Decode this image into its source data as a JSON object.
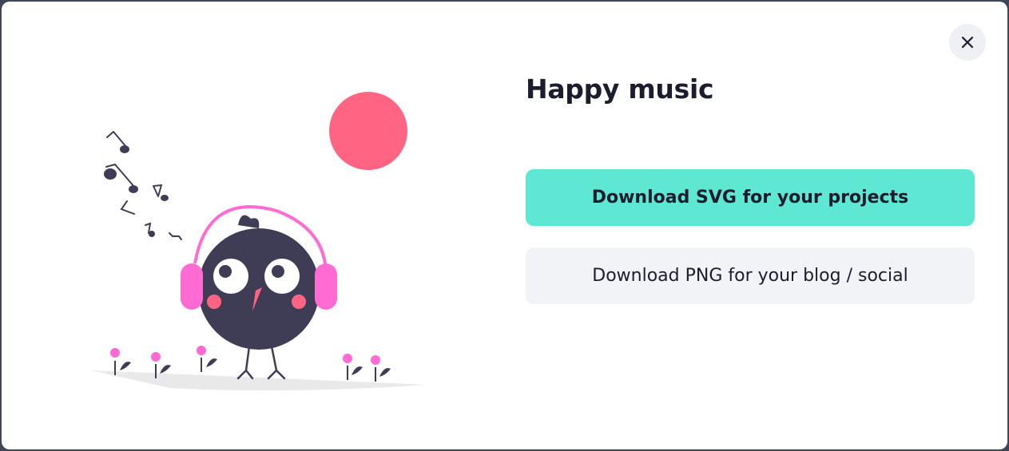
{
  "modal": {
    "title": "Happy music",
    "close_icon": "close-icon"
  },
  "illustration": {
    "subject": "bird-with-headphones-icon",
    "colors": {
      "bird_body": "#3f3d56",
      "headphones": "#ff6bd3",
      "sun": "#ff6582",
      "beak": "#ff6582",
      "ground": "#e6e6e6"
    }
  },
  "actions": {
    "svg_label": "Download SVG for your projects",
    "png_label": "Download PNG for your blog / social"
  },
  "colors": {
    "primary_button": "#5ee8d3",
    "secondary_button": "#f2f3f6",
    "text": "#1b1d2e"
  }
}
